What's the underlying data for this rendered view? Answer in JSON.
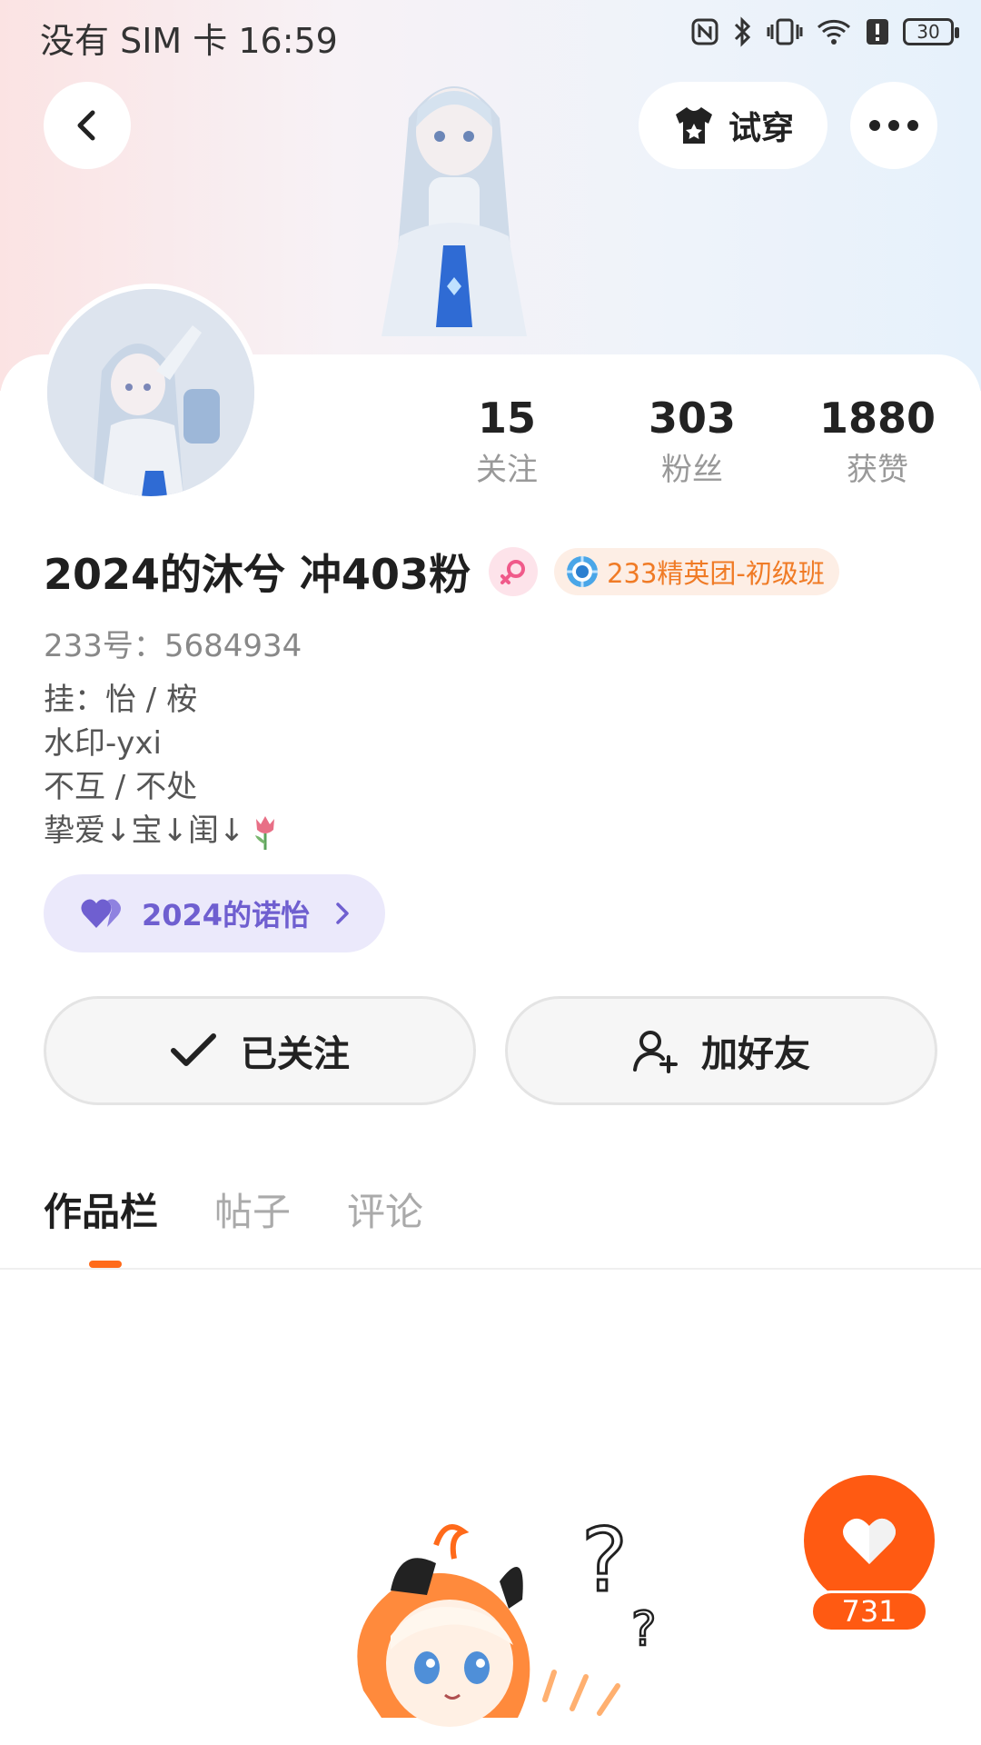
{
  "status_bar": {
    "carrier_time": "没有 SIM 卡 16:59",
    "battery": "30",
    "icons": [
      "nfc-icon",
      "bluetooth-icon",
      "vibrate-icon",
      "wifi-icon",
      "alert-icon",
      "battery-icon"
    ]
  },
  "header": {
    "back_icon": "chevron-left-icon",
    "try_on_label": "试穿",
    "try_on_icon": "shirt-icon",
    "more_icon": "more-dots-icon"
  },
  "profile": {
    "stats": [
      {
        "value": "15",
        "label": "关注"
      },
      {
        "value": "303",
        "label": "粉丝"
      },
      {
        "value": "1880",
        "label": "获赞"
      }
    ],
    "username": "2024的沐兮 冲403粉",
    "gender_icon": "female-icon",
    "group_badge": "233精英团-初级班",
    "user_id": "233号：5684934",
    "bio": [
      "挂：怡 / 桉",
      "水印-yxi",
      "不互 / 不处",
      "挚爱↓宝↓闺↓"
    ],
    "relation_chip": "2024的诺怡"
  },
  "actions": {
    "follow_label": "已关注",
    "add_friend_label": "加好友"
  },
  "tabs": [
    {
      "label": "作品栏",
      "active": true
    },
    {
      "label": "帖子",
      "active": false
    },
    {
      "label": "评论",
      "active": false
    }
  ],
  "like_fab": {
    "count": "731"
  },
  "colors": {
    "accent_orange": "#ff5a12",
    "badge_orange": "#f07b26",
    "relation_purple": "#6f5fd0"
  }
}
